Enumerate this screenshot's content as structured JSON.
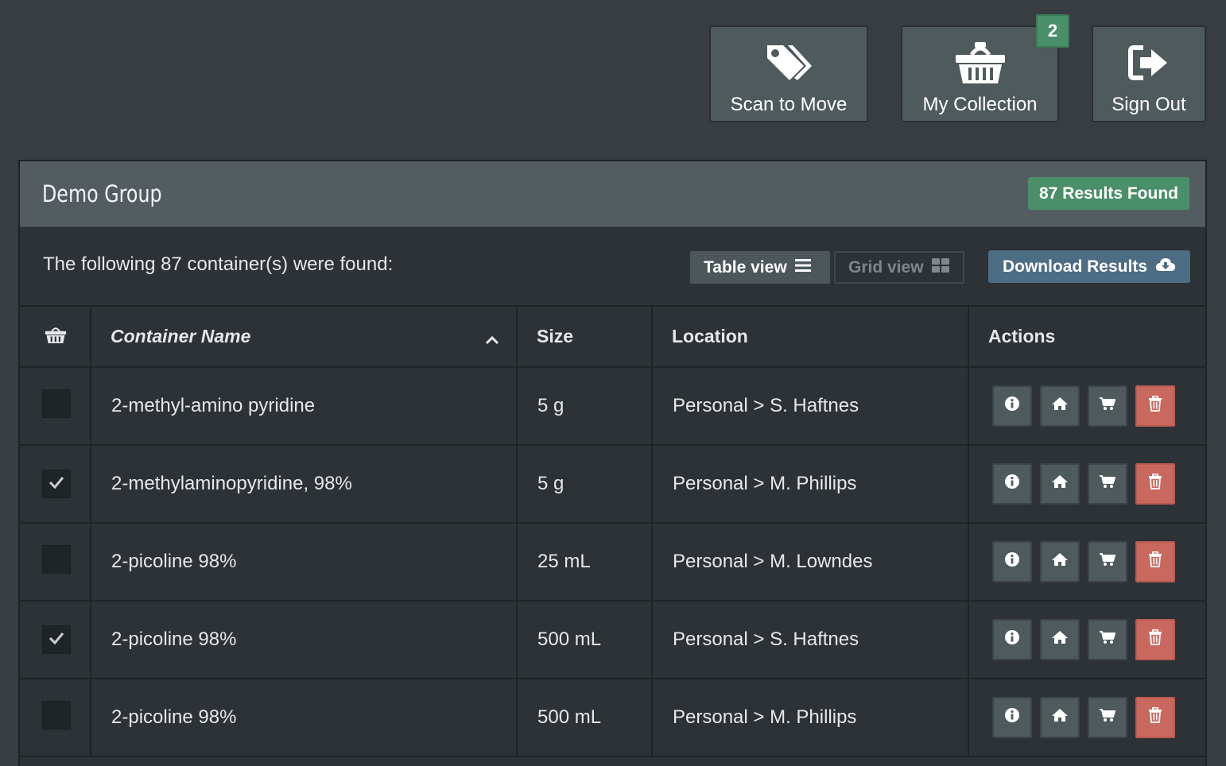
{
  "nav": {
    "scan_label": "Scan to Move",
    "collection_label": "My Collection",
    "collection_count": "2",
    "signout_label": "Sign Out"
  },
  "panel": {
    "title": "Demo Group",
    "results_badge": "87 Results Found",
    "found_text": "The following 87 container(s) were found:",
    "table_view_label": "Table view",
    "grid_view_label": "Grid view",
    "download_label": "Download Results"
  },
  "table": {
    "headers": {
      "name": "Container Name",
      "size": "Size",
      "location": "Location",
      "actions": "Actions"
    },
    "sort": "ascending",
    "rows": [
      {
        "name": "2-methyl-amino pyridine",
        "size": "5 g",
        "location": "Personal > S. Haftnes",
        "checked": false
      },
      {
        "name": "2-methylaminopyridine, 98%",
        "size": "5 g",
        "location": "Personal > M. Phillips",
        "checked": true
      },
      {
        "name": "2-picoline 98%",
        "size": "25 mL",
        "location": "Personal > M. Lowndes",
        "checked": false
      },
      {
        "name": "2-picoline 98%",
        "size": "500 mL",
        "location": "Personal > S. Haftnes",
        "checked": true
      },
      {
        "name": "2-picoline 98%",
        "size": "500 mL",
        "location": "Personal > M. Phillips",
        "checked": false
      }
    ]
  },
  "colors": {
    "background": "#373d41",
    "panel_header": "#535c60",
    "success": "#4a8f6a",
    "primary": "#4d6d84",
    "danger": "#c9685f"
  },
  "icons": [
    "tags-icon",
    "basket-icon",
    "sign-out-icon",
    "list-icon",
    "grid-icon",
    "cloud-download-icon",
    "info-icon",
    "home-icon",
    "cart-icon",
    "trash-icon",
    "check-icon",
    "chevron-up-icon"
  ]
}
